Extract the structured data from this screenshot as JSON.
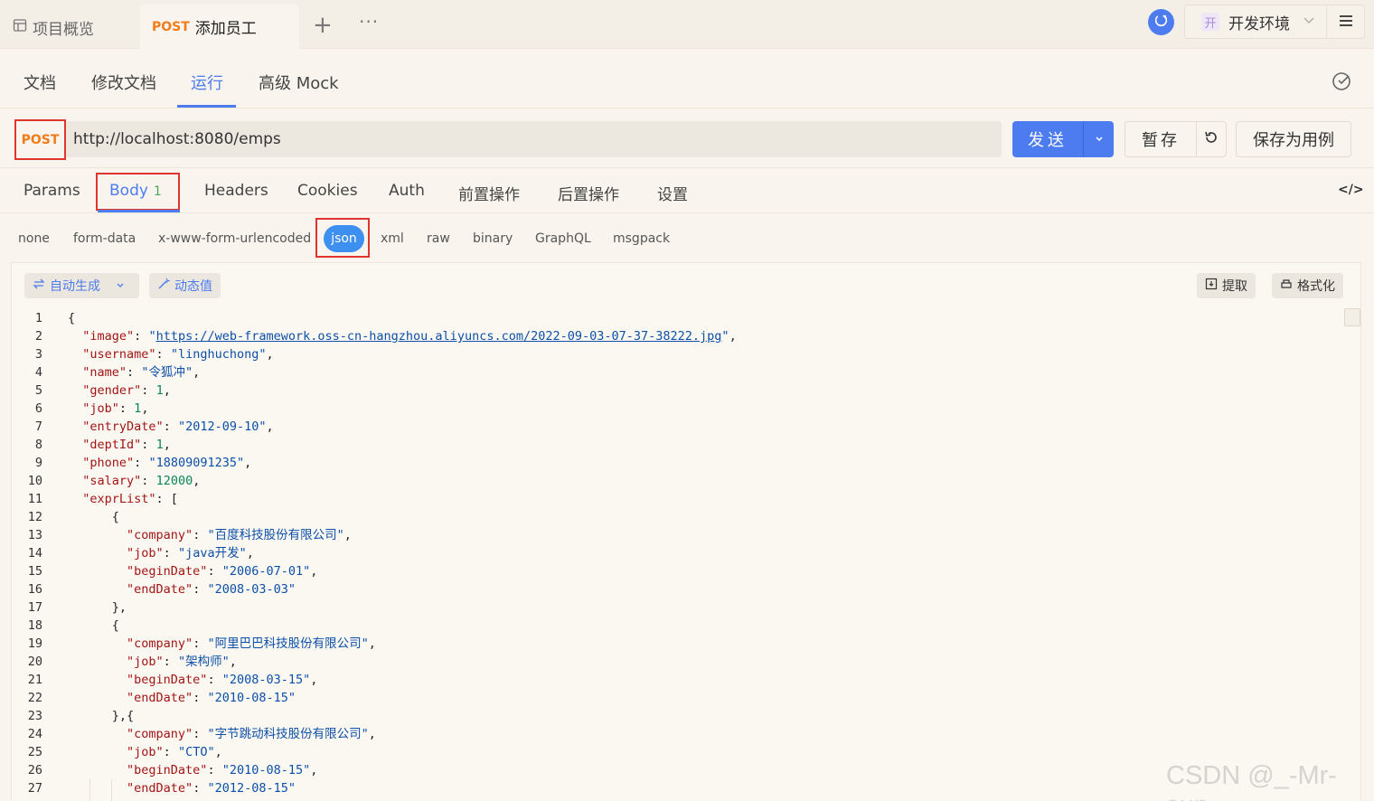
{
  "topbar": {
    "overview_tab": "项目概览",
    "active_tab_method": "POST",
    "active_tab_title": "添加员工",
    "add_tab": "+",
    "more": "···",
    "env_badge": "开",
    "env_name": "开发环境"
  },
  "subnav": {
    "items": [
      "文档",
      "修改文档",
      "运行",
      "高级 Mock"
    ],
    "active": "运行"
  },
  "request": {
    "method": "POST",
    "url": "http://localhost:8080/emps",
    "send_label": "发送",
    "save_label": "暂存",
    "save_case_label": "保存为用例"
  },
  "req_tabs": {
    "params": "Params",
    "body": "Body",
    "body_count": "1",
    "headers": "Headers",
    "cookies": "Cookies",
    "auth": "Auth",
    "pre": "前置操作",
    "post": "后置操作",
    "settings": "设置",
    "code": "</>"
  },
  "body_types": [
    "none",
    "form-data",
    "x-www-form-urlencoded",
    "json",
    "xml",
    "raw",
    "binary",
    "GraphQL",
    "msgpack"
  ],
  "body_type_selected": "json",
  "editor": {
    "auto_generate": "自动生成",
    "dynamic_value": "动态值",
    "extract": "提取",
    "format": "格式化"
  },
  "code_lines": [
    "{",
    "  \"image\": \"https://web-framework.oss-cn-hangzhou.aliyuncs.com/2022-09-03-07-37-38222.jpg\",",
    "  \"username\": \"linghuchong\",",
    "  \"name\": \"令狐冲\",",
    "  \"gender\": 1,",
    "  \"job\": 1,",
    "  \"entryDate\": \"2012-09-10\",",
    "  \"deptId\": 1,",
    "  \"phone\": \"18809091235\",",
    "  \"salary\": 12000,",
    "  \"exprList\": [",
    "      {",
    "        \"company\": \"百度科技股份有限公司\",",
    "        \"job\": \"java开发\",",
    "        \"beginDate\": \"2006-07-01\",",
    "        \"endDate\": \"2008-03-03\"",
    "      },",
    "      {",
    "        \"company\": \"阿里巴巴科技股份有限公司\",",
    "        \"job\": \"架构师\",",
    "        \"beginDate\": \"2008-03-15\",",
    "        \"endDate\": \"2010-08-15\"",
    "      },{",
    "        \"company\": \"字节跳动科技股份有限公司\",",
    "        \"job\": \"CTO\",",
    "        \"beginDate\": \"2010-08-15\",",
    "        \"endDate\": \"2012-08-15\""
  ],
  "watermark": "CSDN @_-Mr-sun",
  "colors": {
    "accent": "#4d7cf0",
    "method": "#f07c1a",
    "highlight_box": "#e0342e",
    "json_pill": "#3d8ff0"
  }
}
